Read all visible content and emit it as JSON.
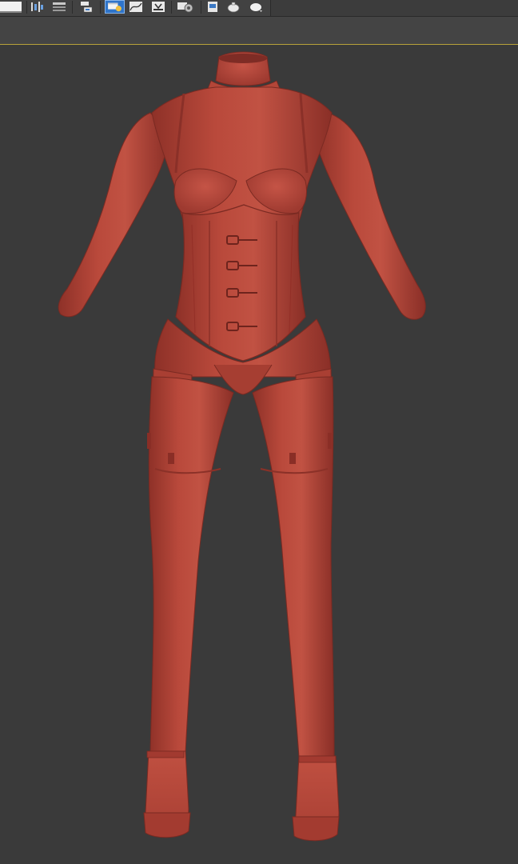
{
  "toolbar": {
    "buttons": [
      {
        "name": "render-frame-button",
        "icon": "white-frame-icon"
      },
      {
        "name": "align-button",
        "icon": "align-icon"
      },
      {
        "name": "layer-manager-button",
        "icon": "layers-icon"
      },
      {
        "name": "scene-explorer-button",
        "icon": "scene-explorer-icon"
      },
      {
        "name": "material-editor-button",
        "icon": "material-editor-icon",
        "active": true
      },
      {
        "name": "curve-editor-button",
        "icon": "curve-editor-icon"
      },
      {
        "name": "schematic-view-button",
        "icon": "schematic-icon"
      },
      {
        "name": "render-setup-button",
        "icon": "render-setup-icon"
      },
      {
        "name": "rendered-frame-window-button",
        "icon": "frame-window-icon"
      },
      {
        "name": "render-production-button",
        "icon": "teapot-icon"
      },
      {
        "name": "render-iterative-button",
        "icon": "teapot-dropdown-icon"
      }
    ],
    "accent_color": "#2f74c9"
  },
  "viewport": {
    "background": "#3a3a3a",
    "active_border_color": "#b8a23a",
    "model": {
      "subject": "female-body-corset-outfit",
      "material_color": "#b5473a"
    }
  }
}
